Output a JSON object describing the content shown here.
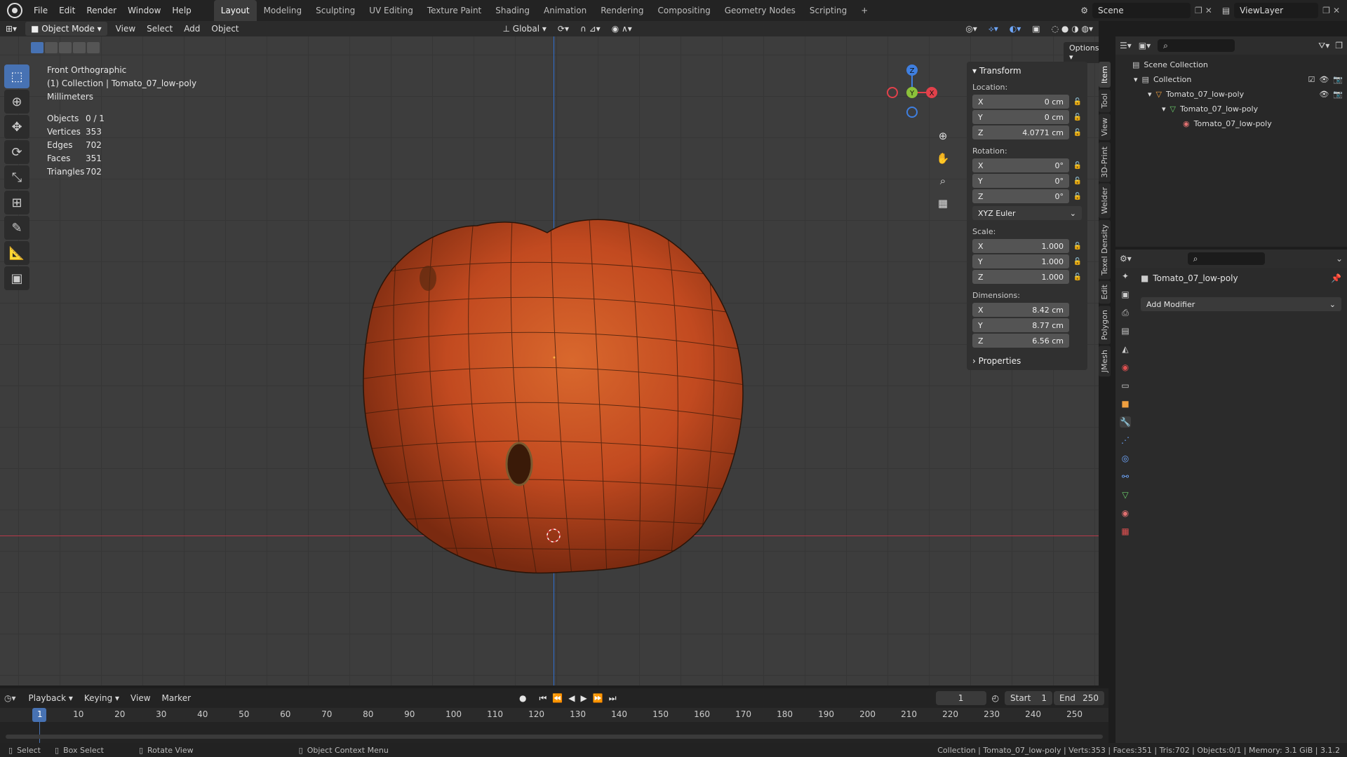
{
  "topbar": {
    "menus": [
      "File",
      "Edit",
      "Render",
      "Window",
      "Help"
    ],
    "workspaces": [
      "Layout",
      "Modeling",
      "Sculpting",
      "UV Editing",
      "Texture Paint",
      "Shading",
      "Animation",
      "Rendering",
      "Compositing",
      "Geometry Nodes",
      "Scripting"
    ],
    "active_workspace": "Layout",
    "add_tab": "+",
    "scene": "Scene",
    "view_layer": "ViewLayer"
  },
  "viewport_header": {
    "mode": "Object Mode",
    "menus": [
      "View",
      "Select",
      "Add",
      "Object"
    ],
    "orientation": "Global",
    "options": "Options"
  },
  "overlay": {
    "view_name": "Front Orthographic",
    "collection_line": "(1) Collection | Tomato_07_low-poly",
    "units": "Millimeters",
    "stats": [
      {
        "k": "Objects",
        "v": "0 / 1"
      },
      {
        "k": "Vertices",
        "v": "353"
      },
      {
        "k": "Edges",
        "v": "702"
      },
      {
        "k": "Faces",
        "v": "351"
      },
      {
        "k": "Triangles",
        "v": "702"
      }
    ]
  },
  "gizmo": {
    "z": "Z",
    "y": "Y",
    "x": "X"
  },
  "npanel": {
    "section": "Transform",
    "location_label": "Location:",
    "location": [
      {
        "k": "X",
        "v": "0 cm"
      },
      {
        "k": "Y",
        "v": "0 cm"
      },
      {
        "k": "Z",
        "v": "4.0771 cm"
      }
    ],
    "rotation_label": "Rotation:",
    "rotation": [
      {
        "k": "X",
        "v": "0°"
      },
      {
        "k": "Y",
        "v": "0°"
      },
      {
        "k": "Z",
        "v": "0°"
      }
    ],
    "rotation_mode": "XYZ Euler",
    "scale_label": "Scale:",
    "scale": [
      {
        "k": "X",
        "v": "1.000"
      },
      {
        "k": "Y",
        "v": "1.000"
      },
      {
        "k": "Z",
        "v": "1.000"
      }
    ],
    "dimensions_label": "Dimensions:",
    "dimensions": [
      {
        "k": "X",
        "v": "8.42 cm"
      },
      {
        "k": "Y",
        "v": "8.77 cm"
      },
      {
        "k": "Z",
        "v": "6.56 cm"
      }
    ],
    "properties": "Properties"
  },
  "side_tabs": [
    "Item",
    "Tool",
    "View",
    "3D-Print",
    "Welder",
    "Texel Density",
    "Edit",
    "Polygon",
    "JMesh"
  ],
  "outliner": {
    "rows": [
      {
        "label": "Scene Collection",
        "indent": 0
      },
      {
        "label": "Collection",
        "indent": 1
      },
      {
        "label": "Tomato_07_low-poly",
        "indent": 2
      },
      {
        "label": "Tomato_07_low-poly",
        "indent": 3
      },
      {
        "label": "Tomato_07_low-poly",
        "indent": 4
      }
    ]
  },
  "properties_panel": {
    "object_name": "Tomato_07_low-poly",
    "add_modifier": "Add Modifier"
  },
  "timeline": {
    "menus": [
      "Playback",
      "Keying",
      "View",
      "Marker"
    ],
    "current_frame": "1",
    "start_label": "Start",
    "start": "1",
    "end_label": "End",
    "end": "250",
    "ticks": [
      "1",
      "10",
      "20",
      "30",
      "40",
      "50",
      "60",
      "70",
      "80",
      "90",
      "100",
      "110",
      "120",
      "130",
      "140",
      "150",
      "160",
      "170",
      "180",
      "190",
      "200",
      "210",
      "220",
      "230",
      "240",
      "250"
    ]
  },
  "statusbar": {
    "select": "Select",
    "box_select": "Box Select",
    "rotate_view": "Rotate View",
    "context_menu": "Object Context Menu",
    "info": "Collection | Tomato_07_low-poly | Verts:353 | Faces:351 | Tris:702 | Objects:0/1 | Memory: 3.1 GiB | 3.1.2"
  },
  "colors": {
    "accent": "#4772b3",
    "x_axis": "#e2414b",
    "y_axis": "#8bc13a",
    "z_axis": "#3f7fe0"
  }
}
